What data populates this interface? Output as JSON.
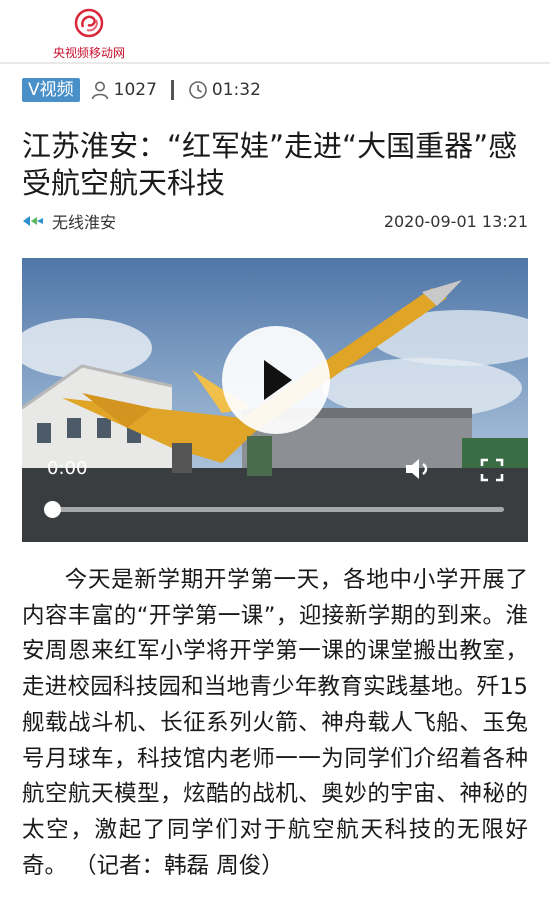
{
  "site": {
    "logo_text": "央视频移动网",
    "logo_icon": "cctv-spiral-logo-icon"
  },
  "meta": {
    "badge": "V视频",
    "views_icon": "person-icon",
    "views": "1027",
    "duration_icon": "clock-icon",
    "duration": "01:32"
  },
  "article": {
    "title": "江苏淮安：“红军娃”走进“大国重器”感受航空航天科技",
    "source_icon": "wireless-huaian-logo-icon",
    "source": "无线淮安",
    "date": "2020-09-01 13:21",
    "body": "今天是新学期开学第一天，各地中小学开展了内容丰富的“开学第一课”，迎接新学期的到来。淮安周恩来红军小学将开学第一课的课堂搬出教室，走进校园科技园和当地青少年教育实践基地。歼15舰载战斗机、长征系列火箭、神舟载人飞船、玉兔号月球车，科技馆内老师一一为同学们介绍着各种航空航天模型，炫酷的战机、奥妙的宇宙、神秘的太空，激起了同学们对于航空航天科技的无限好奇。 （记者：韩磊 周俊）"
  },
  "video": {
    "current_time": "0:00",
    "progress": 0,
    "play_icon": "play-icon",
    "volume_icon": "volume-icon",
    "fullscreen_icon": "fullscreen-icon"
  },
  "colors": {
    "brand": "#c8102e",
    "badge": "#4a90c8"
  }
}
